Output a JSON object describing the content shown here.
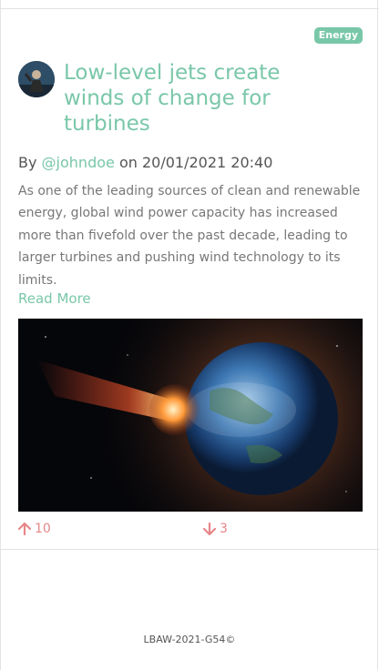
{
  "post": {
    "category": "Energy",
    "title": "Low-level jets create winds of change for turbines",
    "byline_prefix": "By",
    "author": "@johndoe",
    "byline_on": "on",
    "datetime": "20/01/2021 20:40",
    "excerpt": "As one of the leading sources of clean and renewable energy, global wind power capacity has increased more than fivefold over the past decade, leading to larger turbines and pushing wind technology to its limits.",
    "read_more": "Read More",
    "upvotes": "10",
    "downvotes": "3"
  },
  "icons": {
    "upvote": "arrow-up-icon",
    "downvote": "arrow-down-icon"
  },
  "colors": {
    "accent": "#79c7a9",
    "vote": "#e8868a"
  },
  "footer": {
    "text": "LBAW-2021-G54©"
  }
}
